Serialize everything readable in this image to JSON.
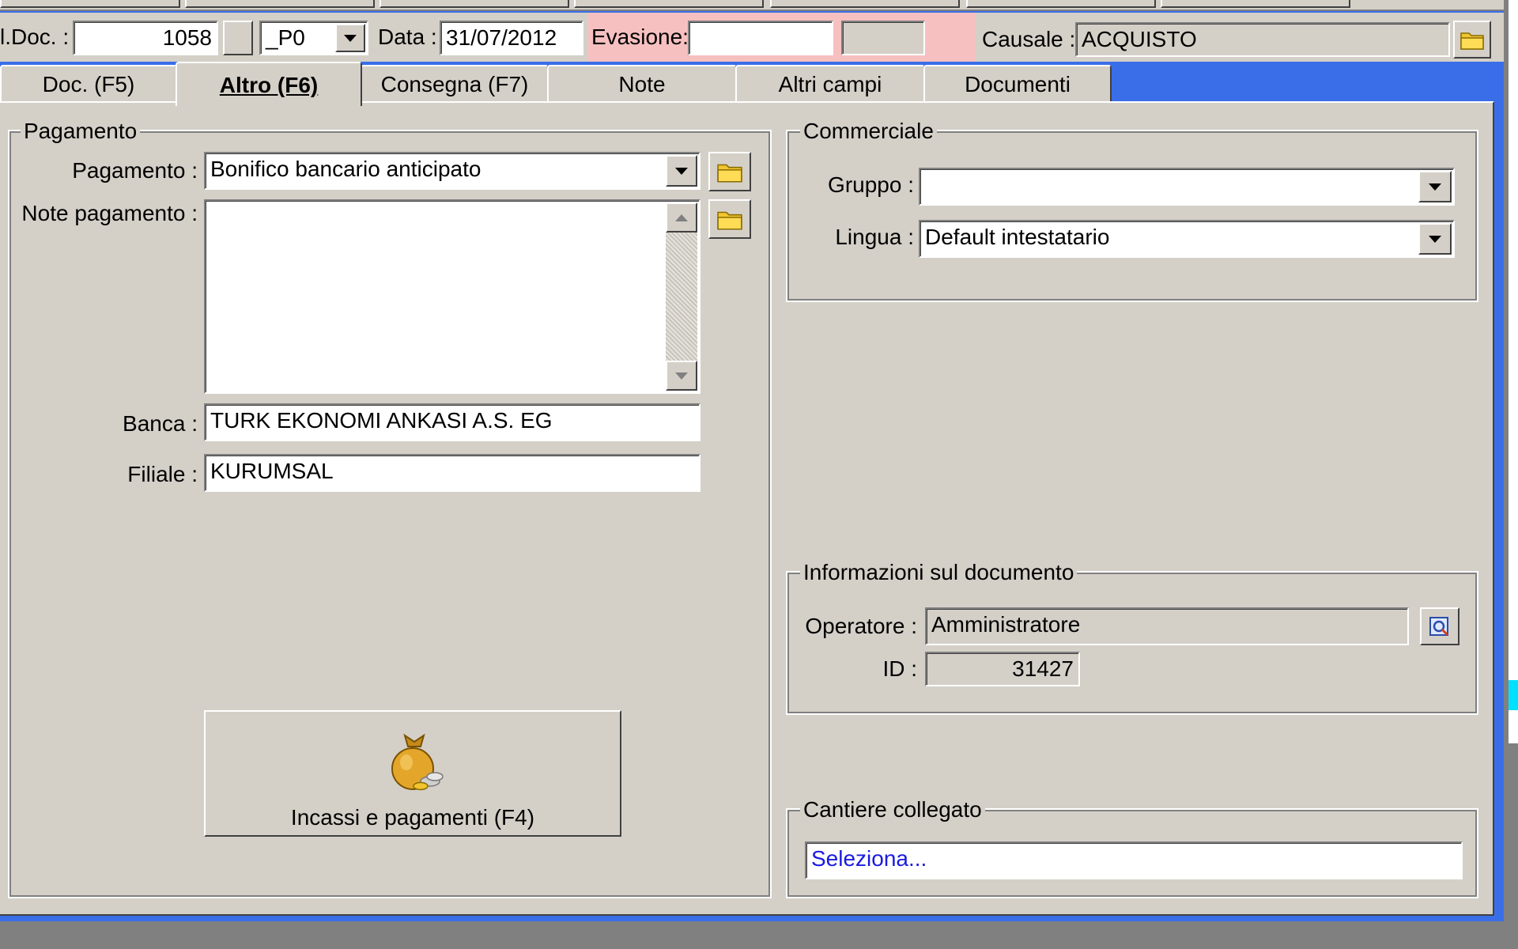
{
  "header": {
    "num_doc_label": "l.Doc. :",
    "num_doc_value": "1058",
    "series_value": "_P0",
    "data_label": "Data :",
    "data_value": "31/07/2012",
    "evasione_label": "Evasione:",
    "evasione_value": "",
    "causale_label": "Causale :",
    "causale_value": "ACQUISTO"
  },
  "tabs": [
    {
      "label": "Doc. (F5)"
    },
    {
      "label": "Altro (F6)",
      "active": true
    },
    {
      "label": "Consegna (F7)"
    },
    {
      "label": "Note"
    },
    {
      "label": "Altri campi"
    },
    {
      "label": "Documenti"
    }
  ],
  "pagamento": {
    "group_title": "Pagamento",
    "pagamento_label": "Pagamento :",
    "pagamento_value": "Bonifico bancario anticipato",
    "note_label": "Note pagamento :",
    "note_value": "",
    "banca_label": "Banca :",
    "banca_value": "TURK EKONOMI ANKASI A.S. EG",
    "filiale_label": "Filiale :",
    "filiale_value": "KURUMSAL",
    "incassi_button_label": "Incassi e pagamenti (F4)"
  },
  "commerciale": {
    "group_title": "Commerciale",
    "gruppo_label": "Gruppo :",
    "gruppo_value": "",
    "lingua_label": "Lingua :",
    "lingua_value": "Default intestatario"
  },
  "informazioni": {
    "group_title": "Informazioni sul documento",
    "operatore_label": "Operatore :",
    "operatore_value": "Amministratore",
    "id_label": "ID :",
    "id_value": "31427"
  },
  "cantiere": {
    "group_title": "Cantiere collegato",
    "link_text": "Seleziona..."
  },
  "colors": {
    "window_bg": "#d4d0c8",
    "window_frame": "#3a6ee8",
    "evasione_bg": "#f7c0c0",
    "link_blue": "#0000ff"
  }
}
